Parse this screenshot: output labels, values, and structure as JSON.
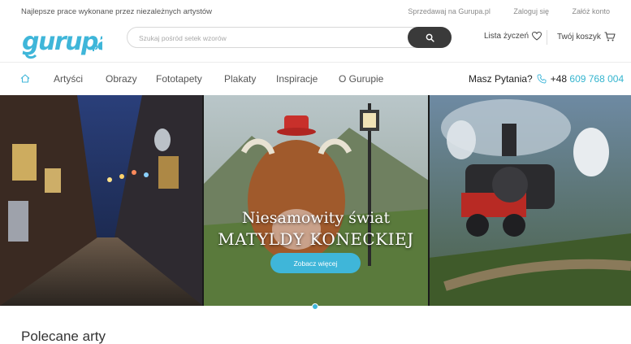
{
  "topbar": {
    "tagline": "Najlepsze prace wykonane przez niezależnych artystów",
    "links": [
      "Sprzedawaj na Gurupa.pl",
      "Zaloguj się",
      "Załóż konto"
    ]
  },
  "header": {
    "logo_text": "Gurupa.pl",
    "search_placeholder": "Szukaj pośród setek wzorów",
    "wishlist_label": "Lista życzeń",
    "cart_label": "Twój koszyk"
  },
  "nav": {
    "items": [
      "Artyści",
      "Obrazy",
      "Fototapety",
      "Plakaty",
      "Inspiracje",
      "O Gurupie"
    ],
    "question": "Masz Pytania?",
    "phone_prefix": "+48",
    "phone_number": "609 768 004"
  },
  "hero": {
    "title_line1": "Niesamowity świat",
    "title_line2": "MATYLDY KONECKIEJ",
    "button_label": "Zobacz więcej"
  },
  "section": {
    "title": "Polecane arty"
  },
  "colors": {
    "accent": "#3fb6d9",
    "dark_button": "#3a3a3a"
  },
  "icons": [
    "home-icon",
    "search-icon",
    "heart-icon",
    "cart-icon",
    "phone-icon"
  ]
}
